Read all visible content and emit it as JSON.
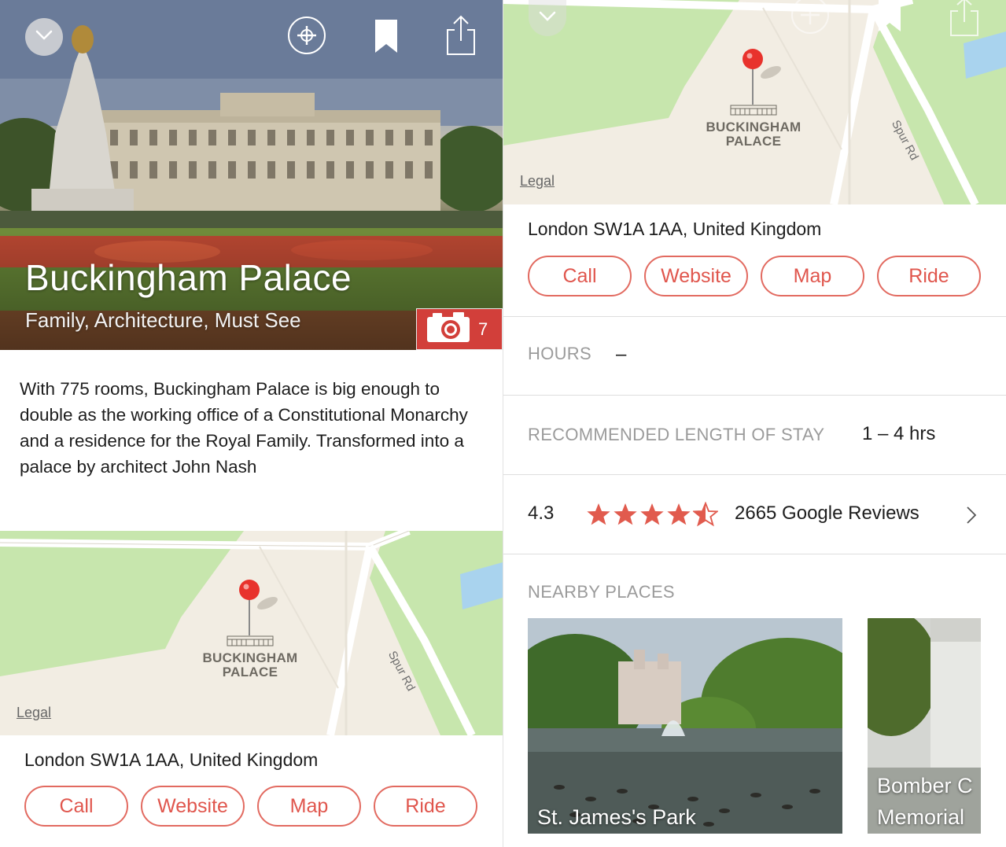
{
  "place": {
    "title": "Buckingham Palace",
    "categories": "Family, Architecture, Must See",
    "photo_count": "7",
    "description": "With 775 rooms, Buckingham Palace is big enough to double as the working office of a Constitutional Monarchy and a residence for the Royal Family. Transformed into a palace by architect John Nash",
    "address": "London SW1A 1AA, United Kingdom"
  },
  "top_bar": {
    "icons": [
      "chevron-down-icon",
      "add-circle-icon",
      "bookmark-icon",
      "share-icon"
    ]
  },
  "map": {
    "legal_label": "Legal",
    "place_label_line1": "BUCKINGHAM",
    "place_label_line2": "PALACE",
    "road_label": "Spur Rd",
    "pin_color": "#e8322c"
  },
  "actions": {
    "call": "Call",
    "website": "Website",
    "map": "Map",
    "ride": "Ride"
  },
  "info": {
    "hours_label": "HOURS",
    "hours_value": "–",
    "stay_label": "RECOMMENDED LENGTH OF STAY",
    "stay_value": "1 – 4 hrs"
  },
  "reviews": {
    "rating": "4.3",
    "stars": 4.3,
    "count_text": "2665 Google Reviews"
  },
  "nearby": {
    "header": "NEARBY PLACES",
    "items": [
      {
        "name": "St. James's Park"
      },
      {
        "name_line1": "Bomber C",
        "name_line2": "Memorial"
      }
    ]
  },
  "colors": {
    "accent": "#e0564d",
    "badge": "#d23f3a",
    "star": "#e15b4e",
    "park_green": "#c7e6ad",
    "map_base": "#f2ede3",
    "water": "#a9d3ee"
  }
}
